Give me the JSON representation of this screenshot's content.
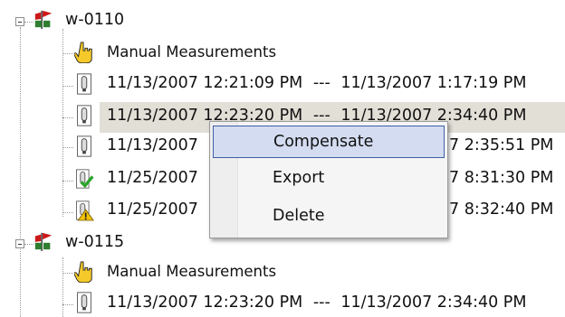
{
  "tree": {
    "groups": [
      {
        "name": "w-0110",
        "children": [
          {
            "type": "manual",
            "label": "Manual Measurements"
          },
          {
            "type": "file",
            "start": "11/13/2007 12:21:09 PM",
            "end": "11/13/2007 1:17:19 PM"
          },
          {
            "type": "file",
            "start": "11/13/2007 12:23:20 PM",
            "end": "11/13/2007 2:34:40 PM",
            "selected": true
          },
          {
            "type": "file",
            "start": "11/13/2007",
            "end": "7 2:35:51 PM"
          },
          {
            "type": "file-check",
            "start": "11/25/2007",
            "end": "7 8:31:30 PM"
          },
          {
            "type": "file-warning",
            "start": "11/25/2007",
            "end": "7 8:32:40 PM"
          }
        ]
      },
      {
        "name": "w-0115",
        "children": [
          {
            "type": "manual",
            "label": "Manual Measurements"
          },
          {
            "type": "file",
            "start": "11/13/2007 12:23:20 PM",
            "end": "11/13/2007 2:34:40 PM"
          }
        ]
      }
    ],
    "separator": "---",
    "separator_short": "—"
  },
  "context_menu": {
    "items": [
      {
        "label": "Compensate",
        "highlighted": true
      },
      {
        "label": "Export"
      },
      {
        "label": "Delete"
      }
    ]
  },
  "icons": {
    "flag": "well-flag-icon",
    "manual": "hand-pointer-icon",
    "file": "data-file-icon",
    "check": "green-check-icon",
    "warning": "warning-triangle-icon"
  },
  "colors": {
    "selection_bg": "#e2dfd7",
    "menu_highlight": "#d4dcf1",
    "menu_highlight_border": "#3e5fa8",
    "flag_red": "#cc1818",
    "check_green": "#2aa52a",
    "warning_yellow": "#f2c200"
  }
}
